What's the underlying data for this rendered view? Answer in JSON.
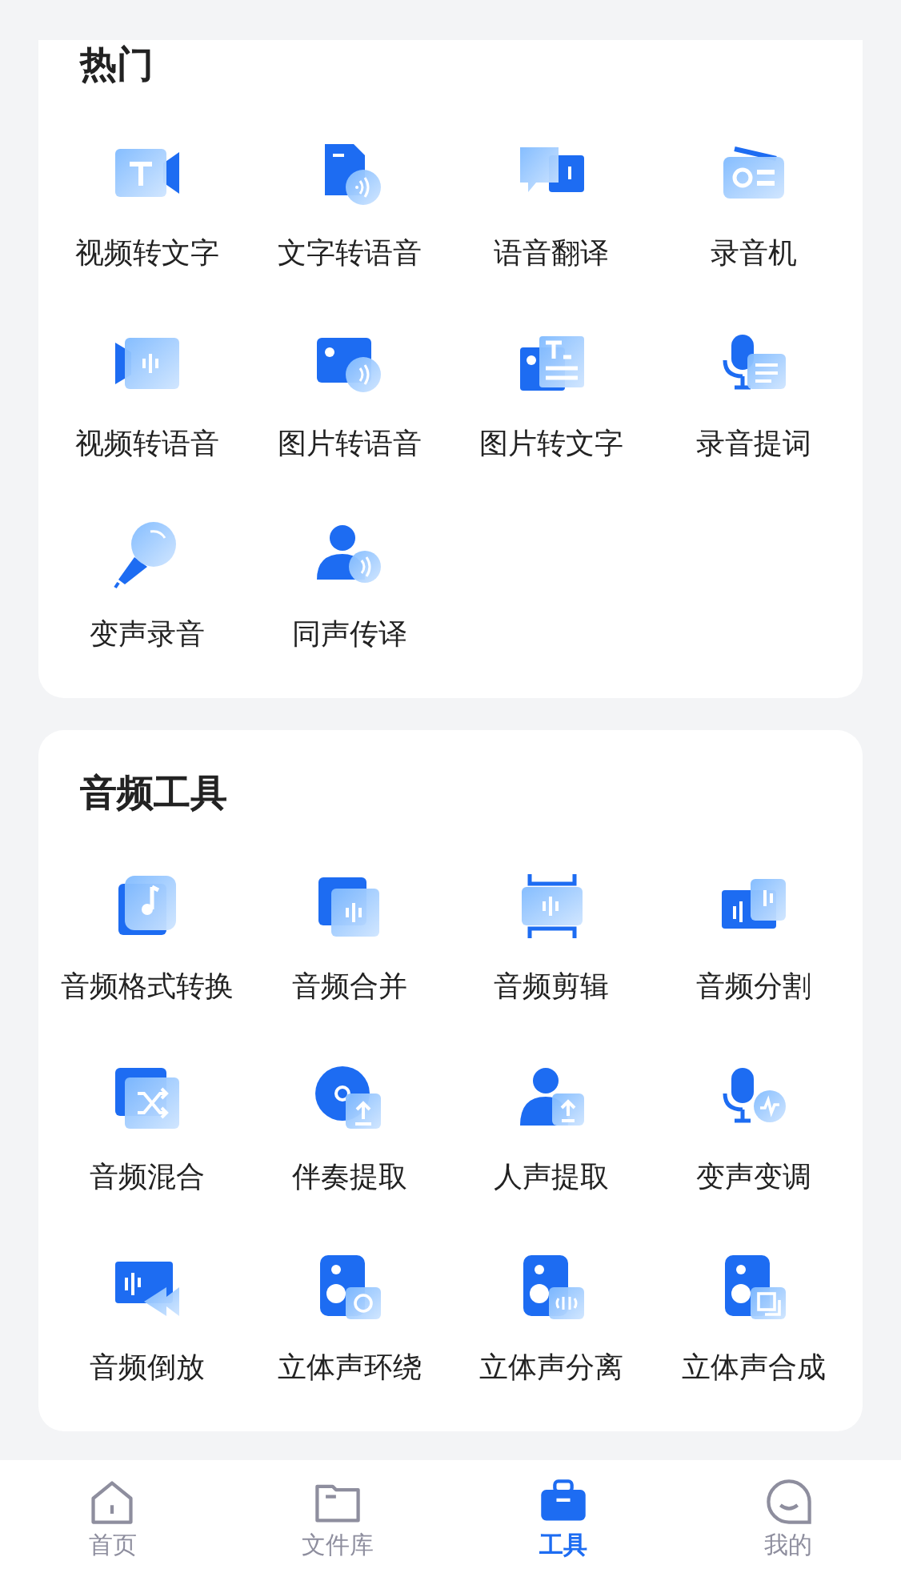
{
  "sections": [
    {
      "title": "热门",
      "tools": [
        {
          "label": "视频转文字"
        },
        {
          "label": "文字转语音"
        },
        {
          "label": "语音翻译"
        },
        {
          "label": "录音机"
        },
        {
          "label": "视频转语音"
        },
        {
          "label": "图片转语音"
        },
        {
          "label": "图片转文字"
        },
        {
          "label": "录音提词"
        },
        {
          "label": "变声录音"
        },
        {
          "label": "同声传译"
        }
      ]
    },
    {
      "title": "音频工具",
      "tools": [
        {
          "label": "音频格式转换"
        },
        {
          "label": "音频合并"
        },
        {
          "label": "音频剪辑"
        },
        {
          "label": "音频分割"
        },
        {
          "label": "音频混合"
        },
        {
          "label": "伴奏提取"
        },
        {
          "label": "人声提取"
        },
        {
          "label": "变声变调"
        },
        {
          "label": "音频倒放"
        },
        {
          "label": "立体声环绕"
        },
        {
          "label": "立体声分离"
        },
        {
          "label": "立体声合成"
        }
      ]
    }
  ],
  "tab_bar": [
    {
      "label": "首页",
      "selected": false
    },
    {
      "label": "文件库",
      "selected": false
    },
    {
      "label": "工具",
      "selected": true
    },
    {
      "label": "我的",
      "selected": false
    }
  ]
}
